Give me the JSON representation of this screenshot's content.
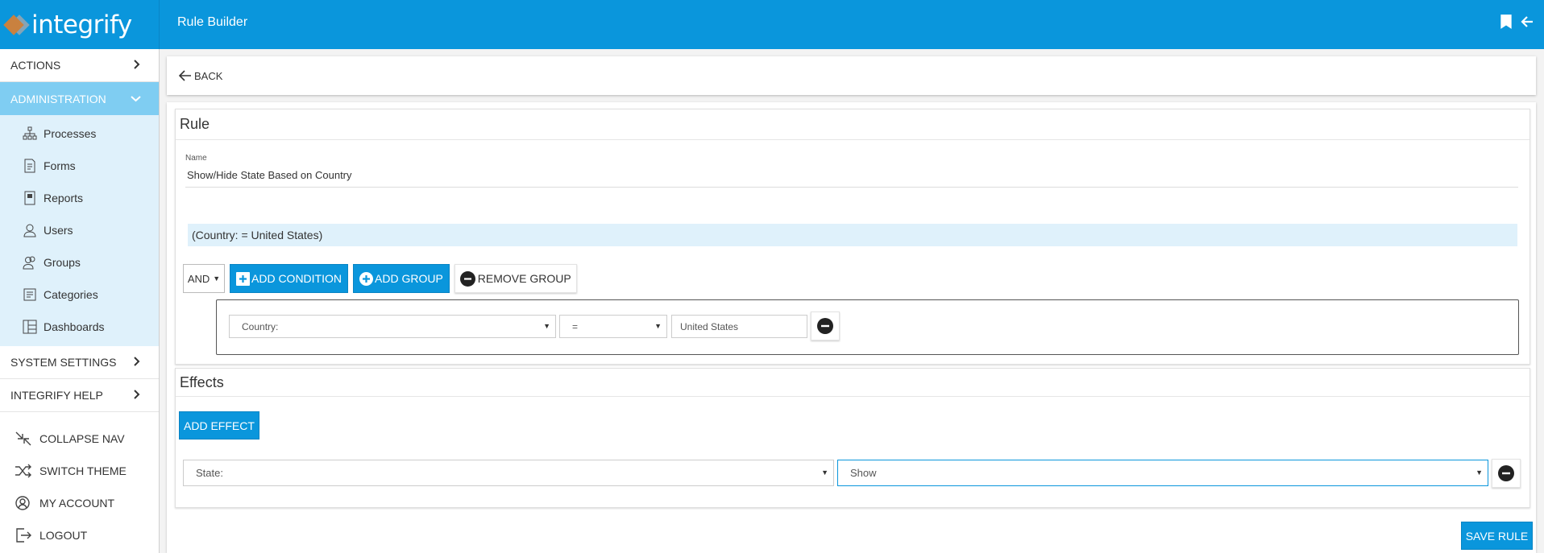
{
  "app": {
    "logo_text": "integrify",
    "page_title": "Rule Builder"
  },
  "sidebar": {
    "actions_label": "ACTIONS",
    "administration_label": "ADMINISTRATION",
    "admin_items": [
      {
        "label": "Processes",
        "icon": "sitemap-icon"
      },
      {
        "label": "Forms",
        "icon": "form-icon"
      },
      {
        "label": "Reports",
        "icon": "report-icon"
      },
      {
        "label": "Users",
        "icon": "user-icon"
      },
      {
        "label": "Groups",
        "icon": "group-icon"
      },
      {
        "label": "Categories",
        "icon": "category-icon"
      },
      {
        "label": "Dashboards",
        "icon": "dashboard-icon"
      }
    ],
    "system_settings_label": "SYSTEM SETTINGS",
    "help_label": "INTEGRIFY HELP",
    "bottom": {
      "collapse_nav": "COLLAPSE NAV",
      "switch_theme": "SWITCH THEME",
      "my_account": "MY ACCOUNT",
      "logout": "LOGOUT"
    }
  },
  "back_label": "BACK",
  "rule": {
    "title": "Rule",
    "name_label": "Name",
    "name_value": "Show/Hide State Based on Country",
    "expression": "(Country: = United States)",
    "logic_operator": "AND",
    "add_condition_label": "ADD CONDITION",
    "add_group_label": "ADD GROUP",
    "remove_group_label": "REMOVE GROUP",
    "condition": {
      "field": "Country:",
      "operator": "=",
      "value": "United States"
    }
  },
  "effects": {
    "title": "Effects",
    "add_effect_label": "ADD EFFECT",
    "effect": {
      "field": "State:",
      "action": "Show"
    }
  },
  "save_rule_label": "SAVE RULE",
  "colors": {
    "brand_blue": "#0a96dc",
    "nav_active": "#7fcdf2",
    "nav_sub_bg": "#dff1fb"
  }
}
